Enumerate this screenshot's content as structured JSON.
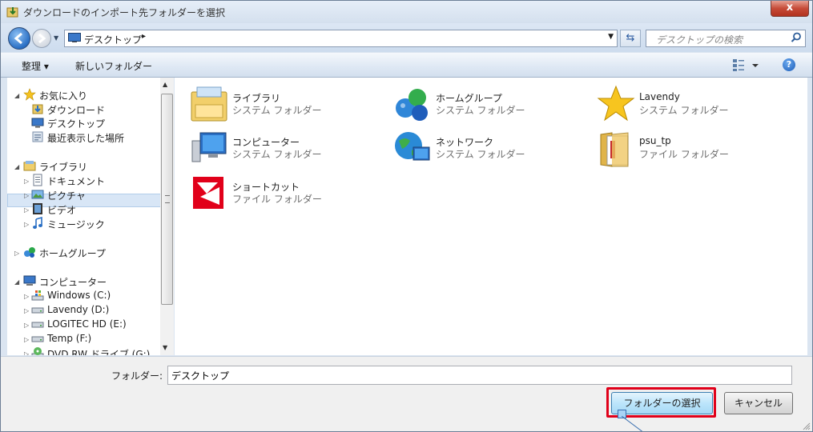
{
  "window": {
    "title": "ダウンロードのインポート先フォルダーを選択",
    "close_label": "x"
  },
  "address": {
    "location": "デスクトップ",
    "separator": "▸",
    "search_placeholder": "デスクトップの検索"
  },
  "toolbar": {
    "organize_label": "整理 ▾",
    "new_folder_label": "新しいフォルダー",
    "help_label": "?"
  },
  "nav": {
    "favorites": "お気に入り",
    "downloads": "ダウンロード",
    "desktop": "デスクトップ",
    "recent": "最近表示した場所",
    "libraries": "ライブラリ",
    "documents": "ドキュメント",
    "pictures": "ピクチャ",
    "videos": "ビデオ",
    "music": "ミュージック",
    "homegroup": "ホームグループ",
    "computer": "コンピューター",
    "drives": [
      "Windows (C:)",
      "Lavendy (D:)",
      "LOGITEC HD (E:)",
      "Temp (F:)",
      "DVD RW ドライブ (G:)"
    ]
  },
  "items": [
    {
      "name": "ライブラリ",
      "type": "システム フォルダー",
      "icon": "library-icon"
    },
    {
      "name": "ホームグループ",
      "type": "システム フォルダー",
      "icon": "homegroup-icon"
    },
    {
      "name": "Lavendy",
      "type": "システム フォルダー",
      "icon": "star-icon"
    },
    {
      "name": "コンピューター",
      "type": "システム フォルダー",
      "icon": "computer-icon"
    },
    {
      "name": "ネットワーク",
      "type": "システム フォルダー",
      "icon": "network-icon"
    },
    {
      "name": "psu_tp",
      "type": "ファイル フォルダー",
      "icon": "folder-icon"
    },
    {
      "name": "ショートカット",
      "type": "ファイル フォルダー",
      "icon": "shortcut-logo-icon"
    }
  ],
  "footer": {
    "folder_label": "フォルダー:",
    "folder_value": "デスクトップ",
    "select_label": "フォルダーの選択",
    "cancel_label": "キャンセル"
  }
}
